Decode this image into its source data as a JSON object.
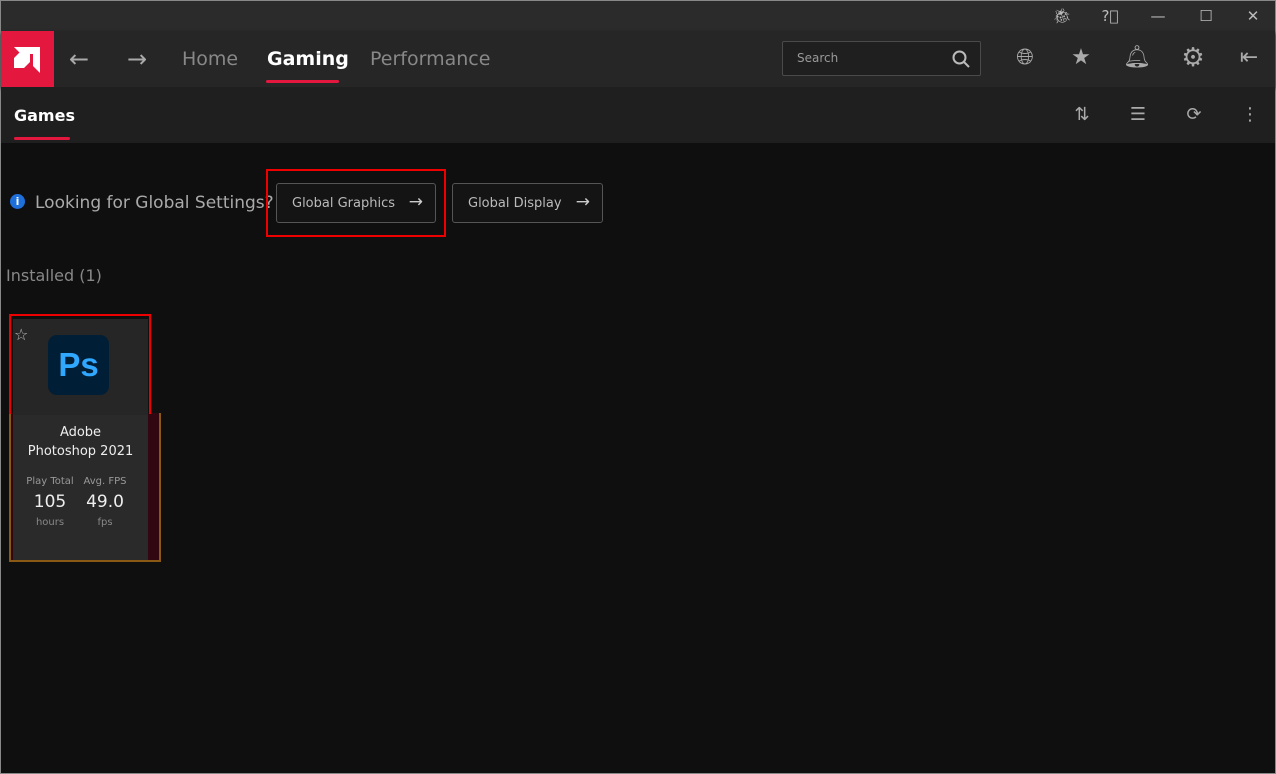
{
  "titlebar": {
    "icons": [
      "bug-icon",
      "help-icon",
      "minimize-icon",
      "maximize-icon",
      "close-icon"
    ]
  },
  "nav": {
    "tabs": [
      {
        "label": "Home"
      },
      {
        "label": "Gaming",
        "active": true
      },
      {
        "label": "Performance"
      }
    ],
    "search_placeholder": "Search",
    "icons": [
      "globe-icon",
      "star-icon",
      "bell-icon",
      "gear-icon",
      "sidebar-toggle-icon"
    ]
  },
  "subnav": {
    "title": "Games",
    "icons": [
      "sort-icon",
      "list-view-icon",
      "refresh-icon",
      "more-icon"
    ]
  },
  "global": {
    "prompt": "Looking for Global Settings?",
    "graphics_label": "Global Graphics",
    "display_label": "Global Display"
  },
  "installed": {
    "heading": "Installed (1)",
    "games": [
      {
        "name": "Adobe Photoshop 2021",
        "icon_text": "Ps",
        "play_label": "Play Total",
        "play_value": "105",
        "play_unit": "hours",
        "fps_label": "Avg. FPS",
        "fps_value": "49.0",
        "fps_unit": "fps"
      }
    ]
  },
  "colors": {
    "accent": "#e4173e",
    "annotation": "#ee0000"
  }
}
